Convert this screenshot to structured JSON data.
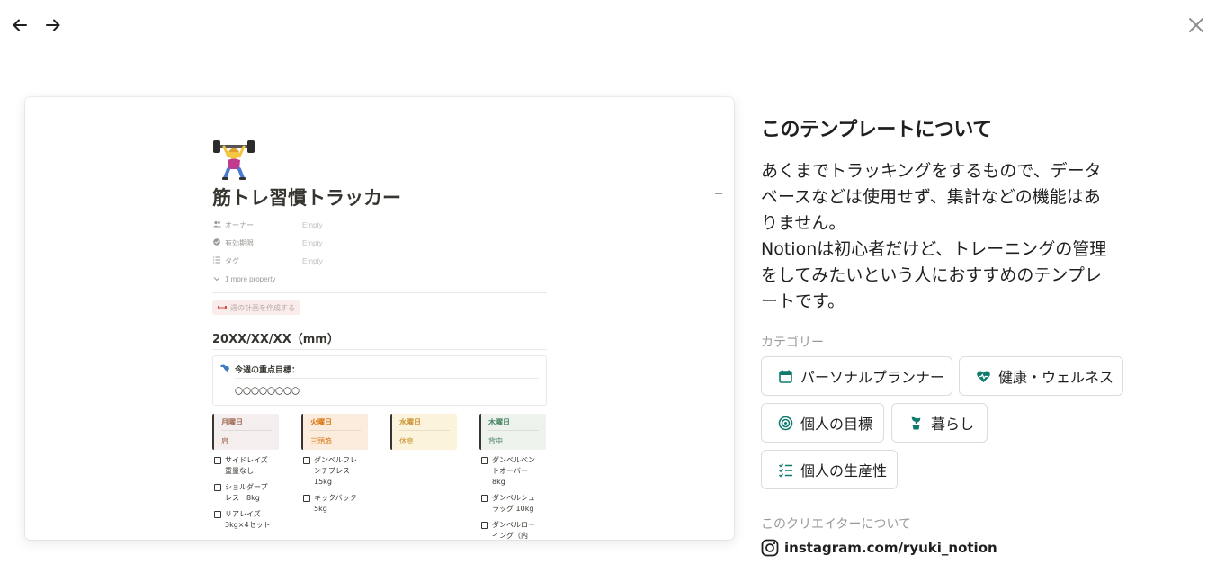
{
  "nav": {
    "back_icon": "arrow-left-icon",
    "forward_icon": "arrow-right-icon",
    "close_icon": "close-icon"
  },
  "preview": {
    "emoji": "person-lifting-weights-emoji",
    "title": "筋トレ習慣トラッカー",
    "properties": [
      {
        "icon": "people-icon",
        "name": "オーナー",
        "value": "Empty"
      },
      {
        "icon": "status-icon",
        "name": "有効期限",
        "value": "Empty"
      },
      {
        "icon": "list-icon",
        "name": "タグ",
        "value": "Empty"
      }
    ],
    "more_property": "1 more property",
    "button_label": "週の計画を作成する",
    "week_heading": "20XX/XX/XX（mm）",
    "callout_title": "今週の重点目標：",
    "callout_body": "〇〇〇〇〇〇〇〇",
    "days": [
      {
        "name": "月曜日",
        "sub": "肩",
        "bg": "#f4eeee",
        "color": "#9f6b53",
        "todos": [
          {
            "t": "サイドレイズ",
            "t2": "重量なし"
          },
          {
            "t": "ショルダープ",
            "t2": "レス　8kg"
          },
          {
            "t": "リアレイズ",
            "t2": "3kg×4セット"
          }
        ]
      },
      {
        "name": "火曜日",
        "sub": "三頭筋",
        "bg": "#fbecdd",
        "color": "#d9730d",
        "todos": [
          {
            "t": "ダンベルフレ",
            "t2": "ンチプレス",
            "t3": "15kg"
          },
          {
            "t": "キックバック",
            "t2": "5kg"
          }
        ]
      },
      {
        "name": "水曜日",
        "sub": "休息",
        "bg": "#fbf3db",
        "color": "#cb912f",
        "todos": []
      },
      {
        "name": "木曜日",
        "sub": "背中",
        "bg": "#edf3ec",
        "color": "#448361",
        "todos": [
          {
            "t": "ダンベルベン",
            "t2": "トオーバー",
            "t3": "8kg"
          },
          {
            "t": "ダンベルシュ",
            "t2": "ラッグ 10kg"
          },
          {
            "t": "ダンベルロー",
            "t2": "イング（内"
          }
        ]
      }
    ]
  },
  "about": {
    "title": "このテンプレートについて",
    "description_lines": [
      "あくまでトラッキングをするもので、データ",
      "ベースなどは使用せず、集計などの機能はあ",
      "りません。",
      "Notionは初心者だけど、トレーニングの管理",
      "をしてみたいという人におすすめのテンプレ",
      "ートです。"
    ]
  },
  "categories": {
    "label": "カテゴリー",
    "accent": "#0f7b6c",
    "items": [
      {
        "label": "パーソナルプランナー",
        "icon": "calendar-icon"
      },
      {
        "label": "健康・ウェルネス",
        "icon": "heart-pulse-icon"
      },
      {
        "label": "個人の目標",
        "icon": "target-icon"
      },
      {
        "label": "暮らし",
        "icon": "plant-icon"
      },
      {
        "label": "個人の生産性",
        "icon": "checklist-icon"
      }
    ]
  },
  "creator": {
    "label": "このクリエイターについて",
    "link": "instagram.com/ryuki_notion",
    "icon": "instagram-icon"
  }
}
